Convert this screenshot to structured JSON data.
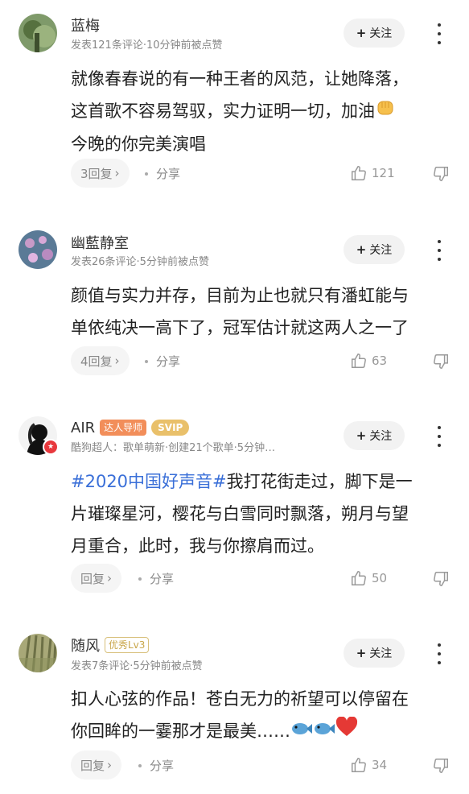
{
  "comments": [
    {
      "username": "蓝梅",
      "meta": "发表121条评论·10分钟前被点赞",
      "follow_label": "关注",
      "content_lines": [
        "就像春春说的有一种王者的风范，让她降落，",
        "这首歌不容易驾驭，实力证明一切，加油",
        "今晚的你完美演唱"
      ],
      "replies_label": "3回复",
      "share_label": "分享",
      "likes": "121"
    },
    {
      "username": "幽藍静室",
      "meta": "发表26条评论·5分钟前被点赞",
      "follow_label": "关注",
      "content_lines": [
        "颜值与实力并存，目前为止也就只有潘虹能与",
        "单依纯决一高下了，冠军估计就这两人之一了"
      ],
      "replies_label": "4回复",
      "share_label": "分享",
      "likes": "63"
    },
    {
      "username": "AIR",
      "tag_expert": "达人导师",
      "tag_svip": "SVIP",
      "meta": "酷狗超人：歌单萌新·创建21个歌单·5分钟…",
      "follow_label": "关注",
      "hashtag": "#2020中国好声音#",
      "content_lines": [
        "我打花街走过，脚下是一",
        "片璀璨星河，樱花与白雪同时飘落，朔月与望",
        "月重合，此时，我与你擦肩而过。"
      ],
      "replies_label": "回复",
      "share_label": "分享",
      "likes": "50"
    },
    {
      "username": "随风",
      "tag_level": "优秀Lv3",
      "meta": "发表7条评论·5分钟前被点赞",
      "follow_label": "关注",
      "content_lines": [
        "扣人心弦的作品！苍白无力的祈望可以停留在",
        "你回眸的一霎那才是最美……"
      ],
      "replies_label": "回复",
      "share_label": "分享",
      "likes": "34"
    }
  ],
  "icons": {
    "follow": "plus-icon",
    "more": "more-vertical-icon",
    "like": "thumbs-up-icon",
    "dislike": "thumbs-down-icon",
    "reply_arrow": "chevron-right-icon"
  },
  "colors": {
    "hashtag": "#3a6fd8",
    "expert_tag": "#f28e5a",
    "svip_tag": "#e9c06a",
    "level_tag": "#c9a64a"
  }
}
